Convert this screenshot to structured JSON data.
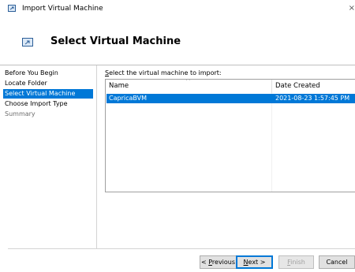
{
  "window": {
    "title": "Import Virtual Machine",
    "close_glyph": "×"
  },
  "header": {
    "title": "Select Virtual Machine",
    "icon": "vm-window-icon"
  },
  "sidebar": {
    "items": [
      {
        "label": "Before You Begin",
        "state": "normal"
      },
      {
        "label": "Locate Folder",
        "state": "normal"
      },
      {
        "label": "Select Virtual Machine",
        "state": "active"
      },
      {
        "label": "Choose Import Type",
        "state": "normal"
      },
      {
        "label": "Summary",
        "state": "disabled"
      }
    ]
  },
  "main": {
    "prompt_accel": "S",
    "prompt_rest": "elect the virtual machine to import:",
    "columns": {
      "name": "Name",
      "date": "Date Created",
      "sort_glyph": "^"
    },
    "rows": [
      {
        "name": "CapricaBVM",
        "date": "2021-08-23 1:57:45 PM",
        "selected": true
      }
    ]
  },
  "buttons": {
    "previous": {
      "prefix": "< ",
      "accel": "P",
      "rest": "revious"
    },
    "next": {
      "accel": "N",
      "rest": "ext >"
    },
    "finish": {
      "accel": "F",
      "rest": "inish"
    },
    "cancel": {
      "label": "Cancel"
    }
  },
  "colors": {
    "selection": "#0078d7",
    "window_bg": "#ffffff",
    "button_bg": "#e1e1e1"
  }
}
